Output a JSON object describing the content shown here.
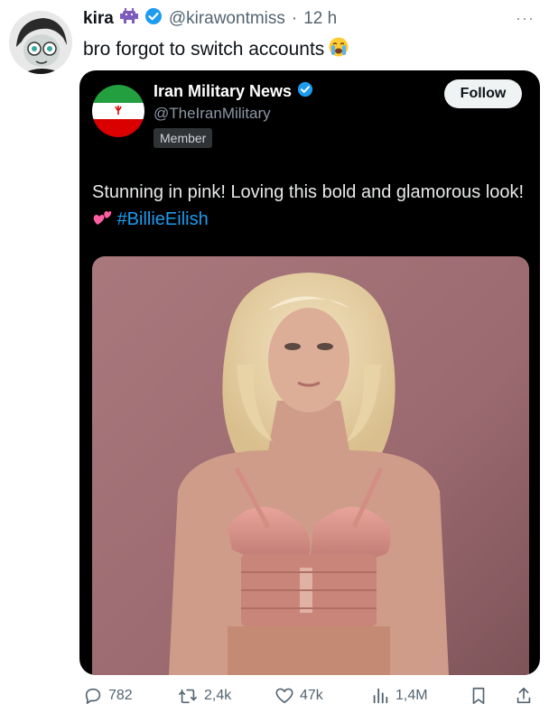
{
  "post": {
    "author_name": "kira",
    "author_handle": "@kirawontmiss",
    "separator": "·",
    "time": "12 h",
    "more_label": "···",
    "text": "bro forgot to switch accounts"
  },
  "quoted": {
    "name": "Iran Military News",
    "handle": "@TheIranMilitary",
    "badge": "Member",
    "follow_label": "Follow",
    "text_before": "Stunning in pink! Loving this bold and glamorous look!",
    "hashtag": "#BillieEilish"
  },
  "actions": {
    "replies": "782",
    "reposts": "2,4k",
    "likes": "47k",
    "views": "1,4M"
  },
  "colors": {
    "verified": "#1d9bf0",
    "card_bg": "#000000",
    "muted": "#536471"
  }
}
